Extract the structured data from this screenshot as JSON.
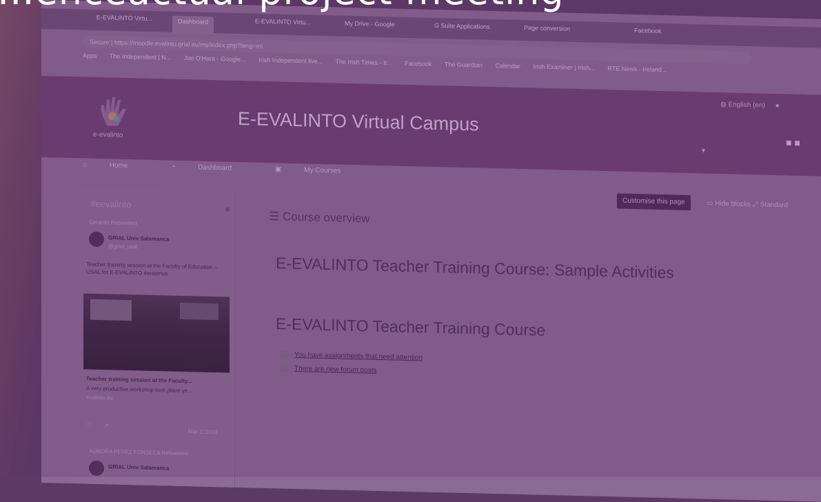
{
  "headline": "...enceactual project meeting",
  "browser": {
    "tabs": [
      "E-EVALINTO Virtu...",
      "Dashboard",
      "E-EVALINTO Virtu...",
      "My Drive - Google",
      "G Suite Applications",
      "Page conversion",
      "Facebook"
    ],
    "address": "Secure | https://moodle.evalinto.grial.eu/my/index.php?lang=en",
    "bookmarks": [
      "Apps",
      "The Independent | N...",
      "Joe O'Hara - Google...",
      "Irish Independent live...",
      "The Irish Times - Ir...",
      "Facebook",
      "The Guardian",
      "Calendar",
      "Irish Examiner | Irish...",
      "RTE News - Ireland..."
    ]
  },
  "site": {
    "logo_text": "e-evalinto",
    "title": "E-EVALINTO Virtual Campus",
    "language": "English (en)",
    "nav": [
      "Home",
      "Dashboard",
      "My Courses"
    ]
  },
  "sidebar": {
    "heading": "#eevalinto",
    "retweet_label": "Gerardo Retweeted",
    "tweet_author": "GRIAL Univ Salamanca",
    "tweet_handle": "@grial_usal",
    "tweet_text": "Teacher training session at the Faculty of Education – USAL for E-EVALINTO #erasmus",
    "card_title": "Teacher training session at the Faculty...",
    "card_desc": "A very productive workshop took place ye...",
    "card_source": "evalinto.eu",
    "date": "Mar 2, 2018",
    "retweet_label_2": "AURORA PEREZ FONSECA Retweeted",
    "tweet_author_2": "GRIAL Univ Salamanca"
  },
  "toolbar": {
    "customise": "Customise this page",
    "hide_blocks": "Hide blocks",
    "standard": "Standard"
  },
  "main": {
    "overview_title": "Course overview",
    "course_1": "E-EVALINTO Teacher Training Course: Sample Activities",
    "course_2": "E-EVALINTO Teacher Training Course",
    "notice_assignments": "You have assignments that need attention",
    "notice_forum": "There are new forum posts"
  }
}
